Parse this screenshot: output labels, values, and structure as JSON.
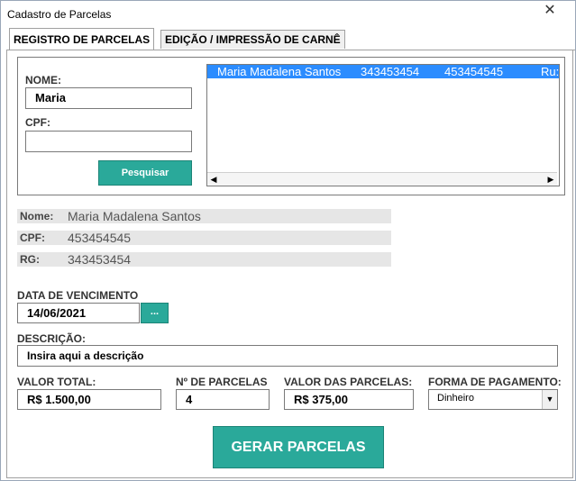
{
  "window": {
    "title": "Cadastro de Parcelas",
    "close_glyph": "✕"
  },
  "tabs": [
    {
      "label": "REGISTRO DE PARCELAS",
      "active": true
    },
    {
      "label": "EDIÇÃO / IMPRESSÃO DE CARNÊ",
      "active": false
    }
  ],
  "search": {
    "name_label": "NOME:",
    "name_value": "Maria",
    "cpf_label": "CPF:",
    "cpf_value": "",
    "button_label": "Pesquisar"
  },
  "results": {
    "rows": [
      {
        "name": "Maria Madalena Santos",
        "rg": "343453454",
        "cpf": "453454545",
        "address": "Ru:"
      }
    ]
  },
  "client": {
    "name_label": "Nome:",
    "name_value": "Maria Madalena Santos",
    "cpf_label": "CPF:",
    "cpf_value": "453454545",
    "rg_label": "RG:",
    "rg_value": "343453454"
  },
  "form": {
    "due_date_label": "DATA DE VENCIMENTO",
    "due_date_value": "14/06/2021",
    "date_button_label": "...",
    "description_label": "DESCRIÇÃO:",
    "description_value": "Insira aqui a descrição",
    "total_label": "VALOR TOTAL:",
    "total_value": "R$ 1.500,00",
    "installments_label": "Nº DE PARCELAS",
    "installments_value": "4",
    "installment_value_label": "VALOR DAS PARCELAS:",
    "installment_value_value": "R$ 375,00",
    "payment_label": "FORMA DE PAGAMENTO:",
    "payment_value": "Dinheiro",
    "generate_button_label": "GERAR PARCELAS"
  },
  "colors": {
    "accent": "#2aa99a",
    "selection": "#2b8cff"
  }
}
